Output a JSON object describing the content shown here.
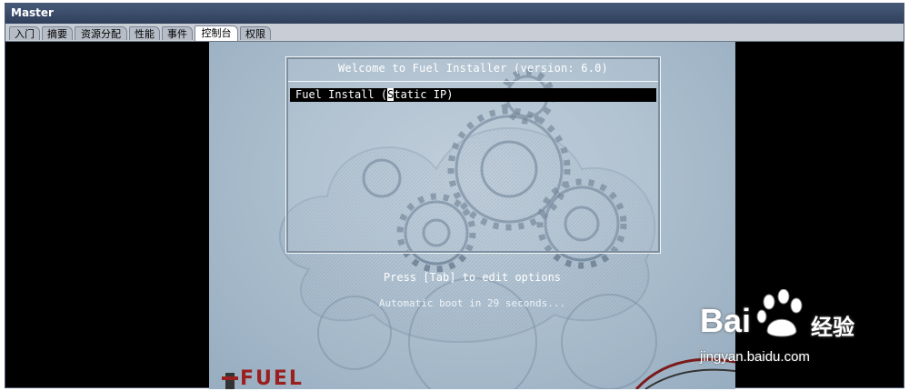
{
  "window": {
    "title": "Master"
  },
  "tabs": [
    {
      "label": "入门"
    },
    {
      "label": "摘要"
    },
    {
      "label": "资源分配"
    },
    {
      "label": "性能"
    },
    {
      "label": "事件"
    },
    {
      "label": "控制台",
      "active": true
    },
    {
      "label": "权限"
    }
  ],
  "installer": {
    "title": "Welcome to Fuel Installer (version: 6.0)",
    "menu_item_prefix": "Fuel Install (",
    "menu_item_cursor": "S",
    "menu_item_suffix": "tatic IP)",
    "hint": "Press [Tab] to edit options",
    "countdown": "Automatic boot in 29 seconds...",
    "logo_text": "FUEL"
  },
  "watermark": {
    "brand": "Bai",
    "brand_cn": "经验",
    "url": "jingyan.baidu.com"
  },
  "colors": {
    "titlebar": "#3b4c6a",
    "logo_red": "#9c1f1f",
    "menu_highlight": "#000000"
  }
}
